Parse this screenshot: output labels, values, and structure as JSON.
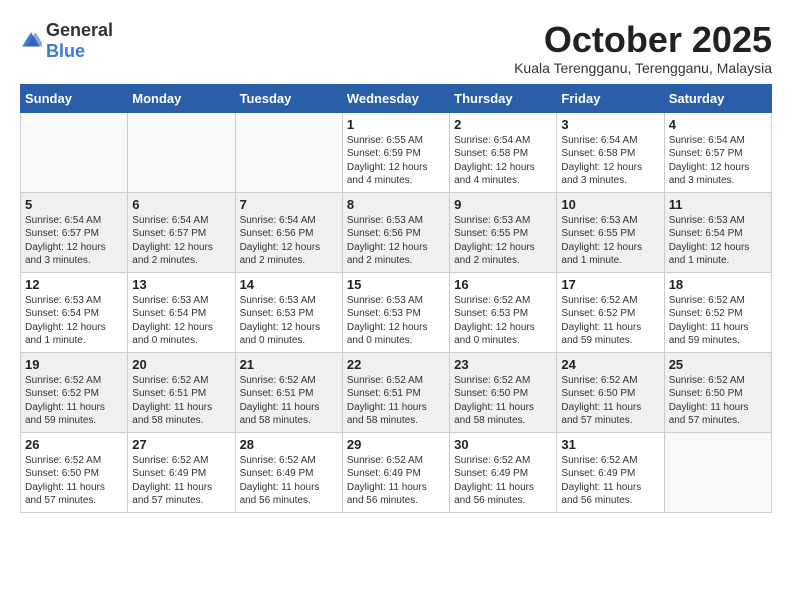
{
  "logo": {
    "general": "General",
    "blue": "Blue"
  },
  "header": {
    "month": "October 2025",
    "location": "Kuala Terengganu, Terengganu, Malaysia"
  },
  "weekdays": [
    "Sunday",
    "Monday",
    "Tuesday",
    "Wednesday",
    "Thursday",
    "Friday",
    "Saturday"
  ],
  "weeks": [
    [
      {
        "day": "",
        "info": ""
      },
      {
        "day": "",
        "info": ""
      },
      {
        "day": "",
        "info": ""
      },
      {
        "day": "1",
        "info": "Sunrise: 6:55 AM\nSunset: 6:59 PM\nDaylight: 12 hours\nand 4 minutes."
      },
      {
        "day": "2",
        "info": "Sunrise: 6:54 AM\nSunset: 6:58 PM\nDaylight: 12 hours\nand 4 minutes."
      },
      {
        "day": "3",
        "info": "Sunrise: 6:54 AM\nSunset: 6:58 PM\nDaylight: 12 hours\nand 3 minutes."
      },
      {
        "day": "4",
        "info": "Sunrise: 6:54 AM\nSunset: 6:57 PM\nDaylight: 12 hours\nand 3 minutes."
      }
    ],
    [
      {
        "day": "5",
        "info": "Sunrise: 6:54 AM\nSunset: 6:57 PM\nDaylight: 12 hours\nand 3 minutes."
      },
      {
        "day": "6",
        "info": "Sunrise: 6:54 AM\nSunset: 6:57 PM\nDaylight: 12 hours\nand 2 minutes."
      },
      {
        "day": "7",
        "info": "Sunrise: 6:54 AM\nSunset: 6:56 PM\nDaylight: 12 hours\nand 2 minutes."
      },
      {
        "day": "8",
        "info": "Sunrise: 6:53 AM\nSunset: 6:56 PM\nDaylight: 12 hours\nand 2 minutes."
      },
      {
        "day": "9",
        "info": "Sunrise: 6:53 AM\nSunset: 6:55 PM\nDaylight: 12 hours\nand 2 minutes."
      },
      {
        "day": "10",
        "info": "Sunrise: 6:53 AM\nSunset: 6:55 PM\nDaylight: 12 hours\nand 1 minute."
      },
      {
        "day": "11",
        "info": "Sunrise: 6:53 AM\nSunset: 6:54 PM\nDaylight: 12 hours\nand 1 minute."
      }
    ],
    [
      {
        "day": "12",
        "info": "Sunrise: 6:53 AM\nSunset: 6:54 PM\nDaylight: 12 hours\nand 1 minute."
      },
      {
        "day": "13",
        "info": "Sunrise: 6:53 AM\nSunset: 6:54 PM\nDaylight: 12 hours\nand 0 minutes."
      },
      {
        "day": "14",
        "info": "Sunrise: 6:53 AM\nSunset: 6:53 PM\nDaylight: 12 hours\nand 0 minutes."
      },
      {
        "day": "15",
        "info": "Sunrise: 6:53 AM\nSunset: 6:53 PM\nDaylight: 12 hours\nand 0 minutes."
      },
      {
        "day": "16",
        "info": "Sunrise: 6:52 AM\nSunset: 6:53 PM\nDaylight: 12 hours\nand 0 minutes."
      },
      {
        "day": "17",
        "info": "Sunrise: 6:52 AM\nSunset: 6:52 PM\nDaylight: 11 hours\nand 59 minutes."
      },
      {
        "day": "18",
        "info": "Sunrise: 6:52 AM\nSunset: 6:52 PM\nDaylight: 11 hours\nand 59 minutes."
      }
    ],
    [
      {
        "day": "19",
        "info": "Sunrise: 6:52 AM\nSunset: 6:52 PM\nDaylight: 11 hours\nand 59 minutes."
      },
      {
        "day": "20",
        "info": "Sunrise: 6:52 AM\nSunset: 6:51 PM\nDaylight: 11 hours\nand 58 minutes."
      },
      {
        "day": "21",
        "info": "Sunrise: 6:52 AM\nSunset: 6:51 PM\nDaylight: 11 hours\nand 58 minutes."
      },
      {
        "day": "22",
        "info": "Sunrise: 6:52 AM\nSunset: 6:51 PM\nDaylight: 11 hours\nand 58 minutes."
      },
      {
        "day": "23",
        "info": "Sunrise: 6:52 AM\nSunset: 6:50 PM\nDaylight: 11 hours\nand 58 minutes."
      },
      {
        "day": "24",
        "info": "Sunrise: 6:52 AM\nSunset: 6:50 PM\nDaylight: 11 hours\nand 57 minutes."
      },
      {
        "day": "25",
        "info": "Sunrise: 6:52 AM\nSunset: 6:50 PM\nDaylight: 11 hours\nand 57 minutes."
      }
    ],
    [
      {
        "day": "26",
        "info": "Sunrise: 6:52 AM\nSunset: 6:50 PM\nDaylight: 11 hours\nand 57 minutes."
      },
      {
        "day": "27",
        "info": "Sunrise: 6:52 AM\nSunset: 6:49 PM\nDaylight: 11 hours\nand 57 minutes."
      },
      {
        "day": "28",
        "info": "Sunrise: 6:52 AM\nSunset: 6:49 PM\nDaylight: 11 hours\nand 56 minutes."
      },
      {
        "day": "29",
        "info": "Sunrise: 6:52 AM\nSunset: 6:49 PM\nDaylight: 11 hours\nand 56 minutes."
      },
      {
        "day": "30",
        "info": "Sunrise: 6:52 AM\nSunset: 6:49 PM\nDaylight: 11 hours\nand 56 minutes."
      },
      {
        "day": "31",
        "info": "Sunrise: 6:52 AM\nSunset: 6:49 PM\nDaylight: 11 hours\nand 56 minutes."
      },
      {
        "day": "",
        "info": ""
      }
    ]
  ]
}
